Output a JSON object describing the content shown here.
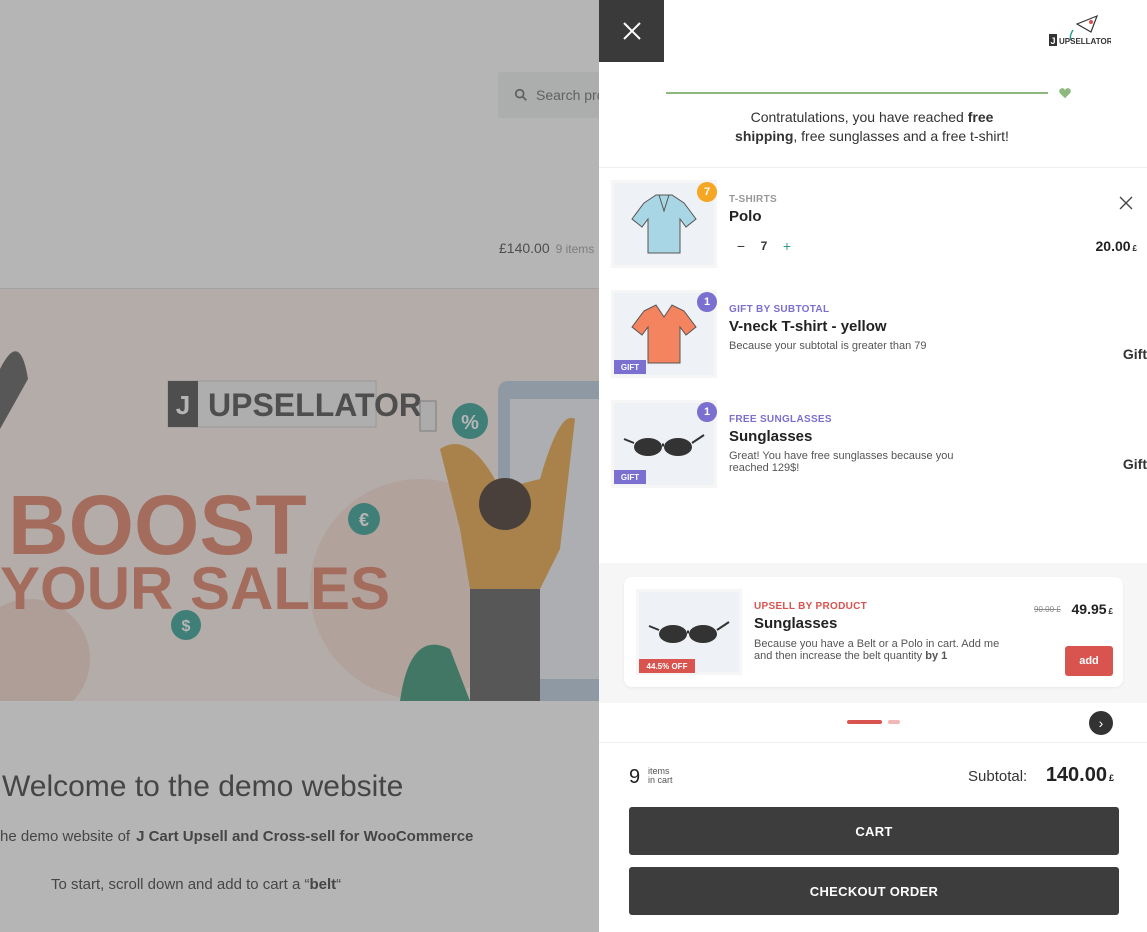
{
  "background": {
    "search_placeholder": "Search pro",
    "header_total": "£140.00",
    "header_items": "9 items",
    "hero": {
      "brand": "UPSELLATOR",
      "brand_letter": "J",
      "headline1": "BOOST",
      "headline2": "YOUR SALES",
      "percent_sign": "%",
      "euro_sign": "€",
      "dollar_sign": "$"
    },
    "welcome_title": "Welcome to the demo website",
    "demo_line_prefix": "he demo website of",
    "demo_line_bold": "J Cart Upsell and Cross-sell for WooCommerce",
    "start_line_prefix": "To start, scroll down and add to cart a “",
    "start_line_bold": "belt",
    "start_line_suffix": "“"
  },
  "drawer": {
    "logo_text": "UPSELLATOR",
    "logo_letter": "J",
    "congrats": {
      "part1": "Contratulations, you have reached ",
      "bold1": "free shipping",
      "part2": ", free sunglasses and a free t-shirt!"
    },
    "cart_items": [
      {
        "category": "T-SHIRTS",
        "title": "Polo",
        "badge": "7",
        "qty_minus": "−",
        "qty": "7",
        "qty_plus": "+",
        "price": "20.00",
        "currency": "£"
      },
      {
        "category": "GIFT BY SUBTOTAL",
        "title": "V-neck T-shirt - yellow",
        "desc": "Because your subtotal is greater than 79",
        "badge": "1",
        "tag": "GIFT",
        "right_label": "Gift"
      },
      {
        "category": "FREE SUNGLASSES",
        "title": "Sunglasses",
        "desc": "Great! You have free sunglasses because you reached 129$!",
        "badge": "1",
        "tag": "GIFT",
        "right_label": "Gift"
      }
    ],
    "upsell": {
      "category": "UPSELL BY PRODUCT",
      "title": "Sunglasses",
      "desc_part": "Because you have a Belt or a Polo in cart. Add me and then increase the belt quantity ",
      "desc_bold": "by 1",
      "tag": "44.5% OFF",
      "old_price": "90.00",
      "old_currency": "£",
      "new_price": "49.95",
      "new_currency": "£",
      "add_label": "add"
    },
    "next_label": "›",
    "footer": {
      "count": "9",
      "count_label_line1": "items",
      "count_label_line2": "in cart",
      "subtotal_label": "Subtotal:",
      "subtotal_value": "140.00",
      "subtotal_currency": "£",
      "cart_label": "CART",
      "checkout_label": "CHECKOUT ORDER"
    }
  },
  "colors": {
    "accent_red": "#d9534f",
    "gift_purple": "#7b6fcf",
    "badge_orange": "#f5a623",
    "progress_green": "#8db87e",
    "dark_button": "#3d3d3d"
  }
}
